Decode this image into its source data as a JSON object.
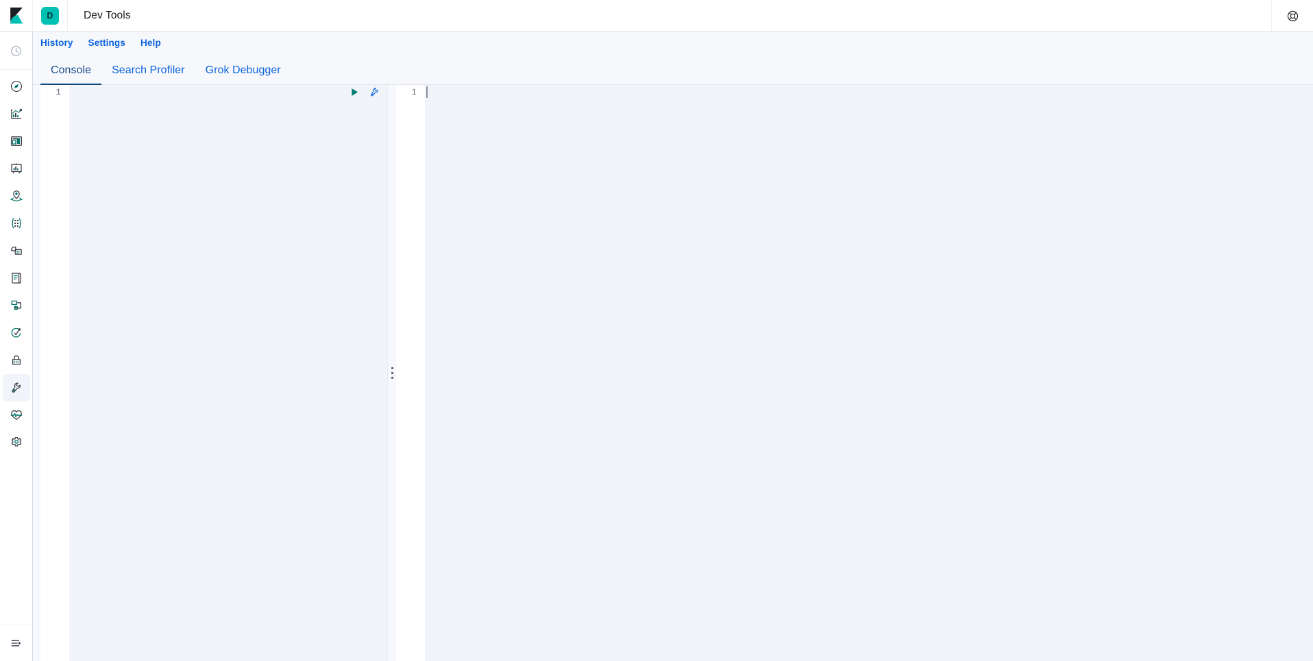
{
  "header": {
    "logo_icon": "kibana-logo",
    "space_badge": "D",
    "title": "Dev Tools",
    "help_icon": "lifebuoy-help-icon"
  },
  "sidebar": {
    "groups": [
      {
        "items": [
          {
            "icon": "recently-viewed-clock-icon",
            "label": "Recently viewed"
          }
        ]
      },
      {
        "items": [
          {
            "icon": "discover-compass-icon",
            "label": "Discover"
          },
          {
            "icon": "dashboards-chart-icon",
            "label": "Dashboards"
          },
          {
            "icon": "canvas-layout-icon",
            "label": "Canvas"
          },
          {
            "icon": "maps-presentation-icon",
            "label": "Maps"
          },
          {
            "icon": "observability-location-icon",
            "label": "Observability"
          },
          {
            "icon": "machine-learning-nodes-icon",
            "label": "Machine Learning"
          },
          {
            "icon": "enterprise-search-icon",
            "label": "Enterprise Search"
          },
          {
            "icon": "logs-document-icon",
            "label": "Logs"
          },
          {
            "icon": "apm-layers-icon",
            "label": "APM"
          },
          {
            "icon": "uptime-check-icon",
            "label": "Uptime"
          },
          {
            "icon": "security-lock-icon",
            "label": "Security"
          },
          {
            "icon": "dev-tools-wrench-icon",
            "label": "Dev Tools",
            "active": true
          },
          {
            "icon": "stack-monitoring-heartbeat-icon",
            "label": "Stack Monitoring"
          },
          {
            "icon": "management-gear-icon",
            "label": "Management"
          }
        ]
      }
    ],
    "collapse": {
      "icon": "collapse-menu-icon",
      "label": "Collapse side navigation"
    }
  },
  "topnav": {
    "links": [
      {
        "label": "History"
      },
      {
        "label": "Settings"
      },
      {
        "label": "Help"
      }
    ]
  },
  "tabs": [
    {
      "label": "Console",
      "active": true
    },
    {
      "label": "Search Profiler",
      "active": false
    },
    {
      "label": "Grok Debugger",
      "active": false
    }
  ],
  "console": {
    "request_editor": {
      "name": "request-editor",
      "line_numbers": [
        "1"
      ],
      "content": "",
      "actions": [
        {
          "icon": "play-send-request-icon",
          "label": "Click to send request"
        },
        {
          "icon": "wrench-options-icon",
          "label": "Open documentation"
        }
      ]
    },
    "response_editor": {
      "name": "response-editor",
      "line_numbers": [
        "1"
      ],
      "content": ""
    },
    "splitter": {
      "icon": "drag-handle-icon",
      "label": "Resize panels"
    }
  },
  "colors": {
    "accent_teal": "#00BFB3",
    "link_blue": "#0b64dd",
    "tab_active": "#14477f",
    "play_green": "#017D73",
    "editor_bg": "#f1f4f8",
    "active_line": "#dadee7",
    "page_bg": "#f7f8fc"
  }
}
